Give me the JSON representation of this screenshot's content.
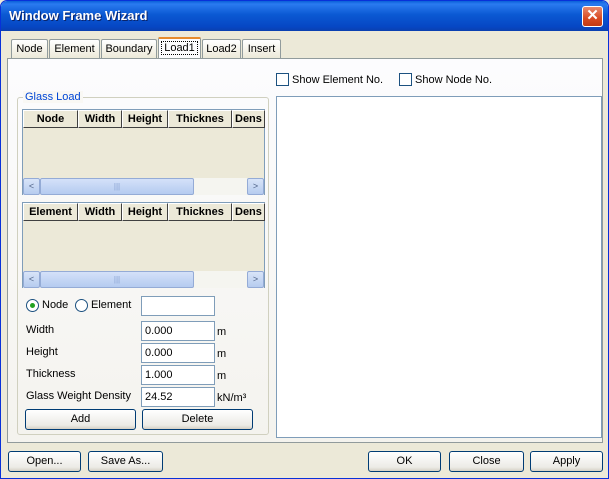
{
  "window": {
    "title": "Window Frame Wizard",
    "close_glyph": "✕"
  },
  "tabs": [
    {
      "label": "Node"
    },
    {
      "label": "Element"
    },
    {
      "label": "Boundary"
    },
    {
      "label": "Load1"
    },
    {
      "label": "Load2"
    },
    {
      "label": "Insert"
    }
  ],
  "active_tab": "Load1",
  "options": {
    "show_element_no": "Show Element No.",
    "show_node_no": "Show Node No."
  },
  "glass_load": {
    "title": "Glass Load",
    "node_table": {
      "columns": [
        "Node",
        "Width",
        "Height",
        "Thicknes",
        "Dens"
      ],
      "rows": []
    },
    "element_table": {
      "columns": [
        "Element",
        "Width",
        "Height",
        "Thicknes",
        "Dens"
      ],
      "rows": []
    },
    "scroll": {
      "left": "<",
      "right": ">",
      "thumb": "|||"
    },
    "mode": {
      "node_label": "Node",
      "element_label": "Element",
      "selected": "Node",
      "id_value": ""
    },
    "fields": [
      {
        "label": "Width",
        "value": "0.000",
        "unit": "m"
      },
      {
        "label": "Height",
        "value": "0.000",
        "unit": "m"
      },
      {
        "label": "Thickness",
        "value": "1.000",
        "unit": "m"
      },
      {
        "label": "Glass Weight Density",
        "value": "24.52",
        "unit": "kN/m³"
      }
    ],
    "add_label": "Add",
    "delete_label": "Delete"
  },
  "footer": {
    "open": "Open...",
    "save_as": "Save As...",
    "ok": "OK",
    "close": "Close",
    "apply": "Apply"
  }
}
